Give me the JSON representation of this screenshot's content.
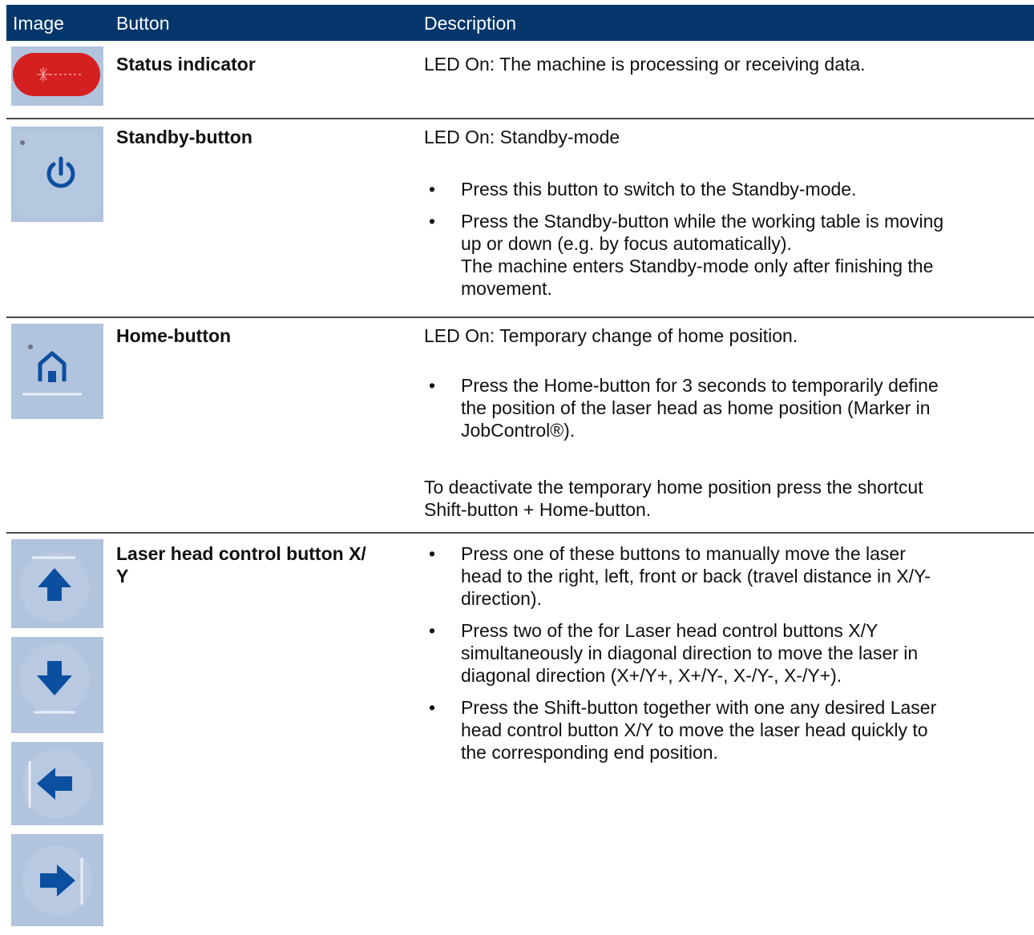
{
  "header": {
    "col_image": "Image",
    "col_button": "Button",
    "col_description": "Description",
    "background": "#04366b"
  },
  "bullet": "•",
  "rows": {
    "status": {
      "icon": "status-indicator-led-icon",
      "name": "Status indicator",
      "led": "LED On: The machine is processing or receiving data."
    },
    "standby": {
      "icon": "power-icon",
      "name": "Standby-button",
      "led": "LED On: Standby-mode",
      "bullets": [
        [
          "Press this button to switch to the Standby-mode."
        ],
        [
          "Press the Standby-button while the working table is moving",
          "up or down (e.g. by focus automatically).",
          "The machine enters Standby-mode only after finishing the",
          "movement."
        ]
      ]
    },
    "home": {
      "icon": "home-icon",
      "name": "Home-button",
      "led": "LED On: Temporary change of home position.",
      "bullets": [
        [
          "Press the Home-button for 3 seconds to temporarily define",
          "the position of the laser head as home position (Marker in",
          "JobControl®)."
        ]
      ],
      "note": [
        "To deactivate the temporary home position press the shortcut",
        "Shift-button + Home-button."
      ]
    },
    "laser": {
      "icons": [
        "arrow-up-icon",
        "arrow-down-icon",
        "arrow-left-end-icon",
        "arrow-right-end-icon"
      ],
      "name": [
        "Laser head control button X/",
        "Y"
      ],
      "bullets": [
        [
          "Press one of these buttons to manually move the laser",
          "head to the right, left, front or back (travel distance in X/Y-",
          "direction)."
        ],
        [
          "Press two of the for Laser head control buttons X/Y",
          "simultaneously in diagonal direction to move the laser in",
          "diagonal direction (X+/Y+, X+/Y-, X-/Y-, X-/Y+)."
        ],
        [
          "Press the Shift-button together with one any desired Laser",
          "head control button X/Y to move the laser head quickly to",
          "the corresponding end position."
        ]
      ]
    }
  },
  "colors": {
    "tile": "#b1c3dd",
    "icon_blue": "#0b4fa0",
    "status_red": "#d42020"
  }
}
